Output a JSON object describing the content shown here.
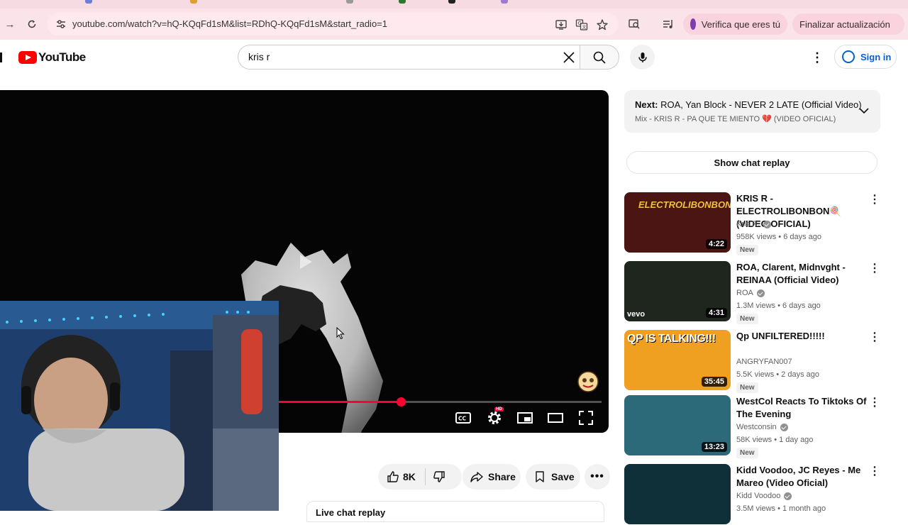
{
  "browser": {
    "url": "youtube.com/watch?v=hQ-KQqFd1sM&list=RDhQ-KQqFd1sM&start_radio=1",
    "profile_pill": "Verifica que eres tú",
    "update_pill": "Finalizar actualización"
  },
  "header": {
    "logo_text": "YouTube",
    "search_value": "kris r",
    "signin_label": "Sign in"
  },
  "player": {
    "progress_fraction": 0.38,
    "hd_badge": "HD"
  },
  "actions": {
    "like_count": "8K",
    "share_label": "Share",
    "save_label": "Save"
  },
  "live_chat_partial": "Live chat replay",
  "up_next": {
    "label": "Next:",
    "title": "ROA, Yan Block - NEVER 2 LATE (Official Video)",
    "mix": "Mix - KRIS R - PA QUE TE MIENTO 💔 (VIDEO OFICIAL)"
  },
  "show_chat_label": "Show chat replay",
  "recommendations": [
    {
      "title": "KRIS R - ELECTROLIBONBON🍭 (VIDEO OFICIAL)",
      "channel": "Kris R.",
      "verified": true,
      "meta": "958K views • 6 days ago",
      "badge": "New",
      "duration": "4:22",
      "thumb_text": "ELECTROLIBONBON",
      "thumb_color": "#4a1512"
    },
    {
      "title": "ROA, Clarent, Midnvght - REINAA (Official Video)",
      "channel": "ROA",
      "verified": true,
      "meta": "1.3M views • 6 days ago",
      "badge": "New",
      "duration": "4:31",
      "thumb_text": "vevo",
      "thumb_color": "#1f261e"
    },
    {
      "title": "Qp UNFILTERED!!!!!",
      "channel": "ANGRYFAN007",
      "verified": false,
      "meta": "5.5K views • 2 days ago",
      "badge": "New",
      "duration": "35:45",
      "thumb_text": "QP IS TALKING!!!",
      "thumb_color": "#f0a020"
    },
    {
      "title": "WestCol Reacts To Tiktoks Of The Evening",
      "channel": "Westconsin",
      "verified": true,
      "meta": "58K views • 1 day ago",
      "badge": "New",
      "duration": "13:23",
      "thumb_text": "",
      "thumb_color": "#2c6a7a"
    },
    {
      "title": "Kidd Voodoo, JC Reyes - Me Mareo (Video Oficial)",
      "channel": "Kidd Voodoo",
      "verified": true,
      "meta": "3.5M views • 1 month ago",
      "badge": "",
      "duration": "",
      "thumb_text": "",
      "thumb_color": "#0f3038"
    }
  ]
}
